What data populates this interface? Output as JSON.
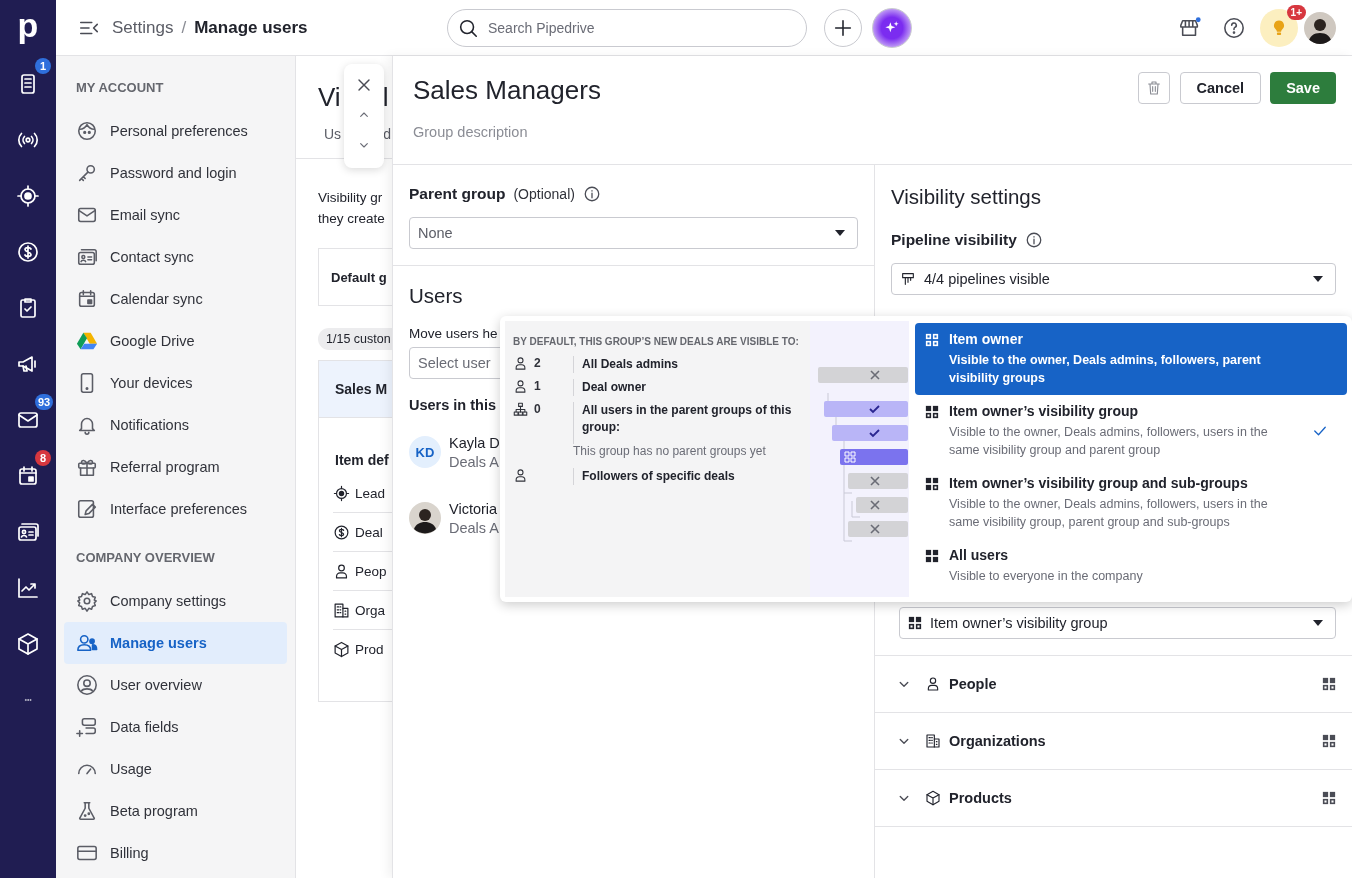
{
  "rail": {
    "logo": "p",
    "items": [
      {
        "selected": false,
        "badge": "1",
        "color": "#2f6fdc"
      },
      {
        "selected": false
      },
      {
        "selected": false
      },
      {
        "selected": false
      },
      {
        "selected": false
      },
      {
        "selected": false
      },
      {
        "selected": false,
        "badge": "93",
        "color": "#2f6fdc"
      },
      {
        "selected": false,
        "badge": "8",
        "color": "#d7373f"
      },
      {
        "selected": false
      },
      {
        "selected": false
      },
      {
        "selected": false
      },
      {
        "selected": false
      }
    ]
  },
  "topbar": {
    "breadcrumb": [
      {
        "label": "Settings",
        "current": false
      },
      {
        "label": "Manage users",
        "current": true
      }
    ],
    "separator": "/",
    "search": {
      "placeholder": "Search Pipedrive"
    },
    "tips_badge": "1+"
  },
  "sidebar": {
    "sections": [
      {
        "title": "MY ACCOUNT",
        "items": [
          {
            "label": "Personal preferences",
            "selected": false
          },
          {
            "label": "Password and login",
            "selected": false
          },
          {
            "label": "Email sync",
            "selected": false
          },
          {
            "label": "Contact sync",
            "selected": false
          },
          {
            "label": "Calendar sync",
            "selected": false
          },
          {
            "label": "Google Drive",
            "selected": false
          },
          {
            "label": "Your devices",
            "selected": false
          },
          {
            "label": "Notifications",
            "selected": false
          },
          {
            "label": "Referral program",
            "selected": false
          },
          {
            "label": "Interface preferences",
            "selected": false
          }
        ]
      },
      {
        "title": "COMPANY OVERVIEW",
        "items": [
          {
            "label": "Company settings",
            "selected": false
          },
          {
            "label": "Manage users",
            "selected": true
          },
          {
            "label": "User overview",
            "selected": false
          },
          {
            "label": "Data fields",
            "selected": false
          },
          {
            "label": "Usage",
            "selected": false
          },
          {
            "label": "Beta program",
            "selected": false
          },
          {
            "label": "Billing",
            "selected": false
          }
        ]
      }
    ]
  },
  "background_page": {
    "title_parts": [
      "Vi",
      "l"
    ],
    "tab_parts": [
      "Us",
      "d"
    ],
    "intro_lines": [
      "Visibility gr",
      "they create"
    ],
    "default_card": "Default g",
    "count_pill": "1/15 custon",
    "selected_card": "Sales M",
    "section_label": "Item def",
    "rows": [
      "Lead",
      "Deal",
      "Peop",
      "Orga",
      "Prod"
    ]
  },
  "panel": {
    "title": "Sales Managers",
    "description": {
      "placeholder": "Group description"
    },
    "cancel": "Cancel",
    "save": "Save",
    "parent_group": {
      "label": "Parent group",
      "hint": "(Optional)",
      "value": "None"
    },
    "users": {
      "title": "Users",
      "move_label": "Move users he",
      "select": {
        "placeholder": "Select user"
      },
      "list_title": "Users in this",
      "members": [
        {
          "kind": "initials",
          "initials": "KD",
          "name": "Kayla D",
          "role": "Deals A"
        },
        {
          "kind": "photo",
          "name": "Victoria",
          "role": "Deals A"
        }
      ]
    },
    "visibility": {
      "title": "Visibility settings",
      "pipeline_label": "Pipeline visibility",
      "pipeline_value": "4/4 pipelines visible",
      "deals_value": "Item owner’s visibility group",
      "entities": [
        {
          "label": "People",
          "expanded": false
        },
        {
          "label": "Organizations",
          "expanded": false
        },
        {
          "label": "Products",
          "expanded": false
        }
      ]
    }
  },
  "popover": {
    "heading": "BY DEFAULT, THIS GROUP’S NEW DEALS ARE VISIBLE TO:",
    "audience": [
      {
        "kind": "user",
        "count": "2",
        "label": "All Deals admins"
      },
      {
        "kind": "user",
        "count": "1",
        "label": "Deal owner"
      },
      {
        "kind": "group",
        "count": "0",
        "label": "All users in the parent groups of this group:",
        "note": "This group has no parent groups yet"
      },
      {
        "kind": "user",
        "label": "Followers of specific deals"
      }
    ],
    "options": [
      {
        "title": "Item owner",
        "description": "Visible to the owner, Deals admins, followers, parent visibility groups",
        "highlighted": true,
        "checked": false
      },
      {
        "title": "Item owner’s visibility group",
        "description": "Visible to the owner, Deals admins, followers, users in the same visibility group and parent group",
        "highlighted": false,
        "checked": true
      },
      {
        "title": "Item owner’s visibility group and sub-groups",
        "description": "Visible to the owner, Deals admins, followers, users in the same visibility group, parent group and sub-groups",
        "highlighted": false,
        "checked": false
      },
      {
        "title": "All users",
        "description": "Visible to everyone in the company",
        "highlighted": false,
        "checked": false
      }
    ]
  }
}
